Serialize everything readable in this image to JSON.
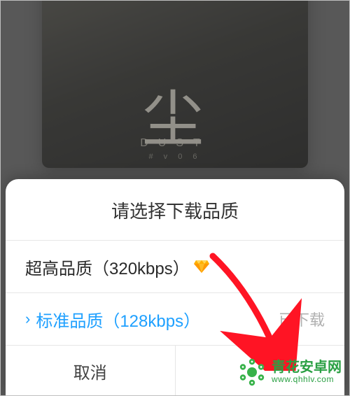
{
  "album": {
    "title": "尘",
    "sub": "DUST",
    "ssub": "# v 0 6"
  },
  "sheet": {
    "header": "请选择下载品质",
    "options": [
      {
        "label": "超高品质（320kbps）",
        "status": "",
        "vip": true,
        "selected": false,
        "color": "#2a2a2a"
      },
      {
        "label": "标准品质（128kbps）",
        "status": "已下载",
        "vip": false,
        "selected": true,
        "color": "#1ea0ff"
      }
    ],
    "footer": {
      "cancel": "取消",
      "confirm": ""
    }
  },
  "annotation": {
    "arrow_color": "#ff1424"
  },
  "watermark": {
    "line1": "青花安卓网",
    "line2": "www.qhhlv.com",
    "color": "#2aa043"
  }
}
